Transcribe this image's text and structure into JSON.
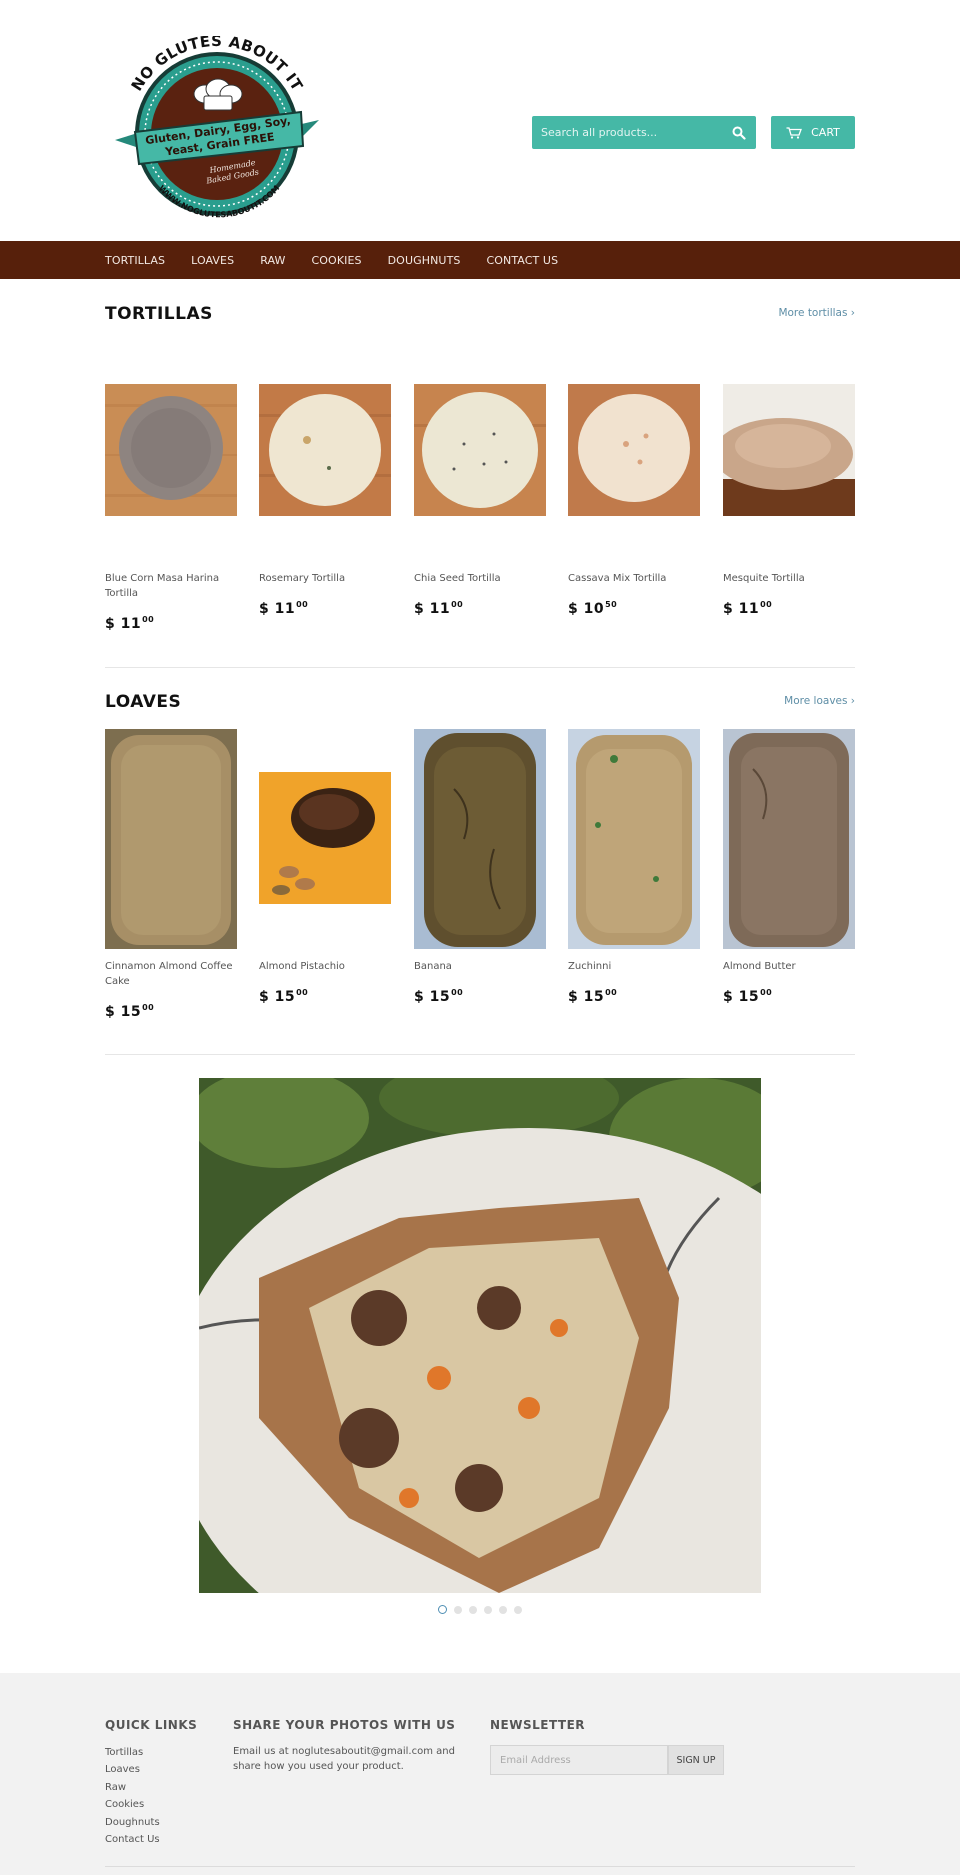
{
  "brand": {
    "logo_arc_text": "NO GLUTES ABOUT IT",
    "logo_banner_line1": "Gluten, Dairy, Egg, Soy,",
    "logo_banner_line2": "Yeast, Grain FREE",
    "logo_sub_line1": "Homemade",
    "logo_sub_line2": "Baked Goods",
    "logo_url_text": "WWW.NOGLUTESABOUTIT.COM",
    "colors": {
      "brown": "#57200b",
      "teal": "#45b8a6"
    }
  },
  "search": {
    "placeholder": "Search all products...",
    "icon": "search-icon"
  },
  "cart": {
    "label": "CART",
    "icon": "cart-icon"
  },
  "nav": {
    "items": [
      {
        "label": "TORTILLAS"
      },
      {
        "label": "LOAVES"
      },
      {
        "label": "RAW"
      },
      {
        "label": "COOKIES"
      },
      {
        "label": "DOUGHNUTS"
      },
      {
        "label": "CONTACT US"
      }
    ]
  },
  "tortillas": {
    "title": "TORTILLAS",
    "more_link": "More tortillas ›",
    "products": [
      {
        "name": "Blue Corn Masa Harina Tortilla",
        "currency": "$ ",
        "price_main": "11",
        "price_cents": "00"
      },
      {
        "name": "Rosemary Tortilla",
        "currency": "$ ",
        "price_main": "11",
        "price_cents": "00"
      },
      {
        "name": "Chia Seed Tortilla",
        "currency": "$ ",
        "price_main": "11",
        "price_cents": "00"
      },
      {
        "name": "Cassava Mix Tortilla",
        "currency": "$ ",
        "price_main": "10",
        "price_cents": "50"
      },
      {
        "name": "Mesquite Tortilla",
        "currency": "$ ",
        "price_main": "11",
        "price_cents": "00"
      }
    ]
  },
  "loaves": {
    "title": "LOAVES",
    "more_link": "More loaves ›",
    "products": [
      {
        "name": "Cinnamon Almond Coffee Cake",
        "currency": "$ ",
        "price_main": "15",
        "price_cents": "00"
      },
      {
        "name": "Almond Pistachio",
        "currency": "$ ",
        "price_main": "15",
        "price_cents": "00"
      },
      {
        "name": "Banana",
        "currency": "$ ",
        "price_main": "15",
        "price_cents": "00"
      },
      {
        "name": "Zuchinni",
        "currency": "$ ",
        "price_main": "15",
        "price_cents": "00"
      },
      {
        "name": "Almond Butter",
        "currency": "$ ",
        "price_main": "15",
        "price_cents": "00"
      }
    ]
  },
  "slideshow": {
    "slide_count": 6,
    "active_index": 0
  },
  "footer": {
    "quick_links": {
      "title": "QUICK LINKS",
      "items": [
        "Tortillas",
        "Loaves",
        "Raw",
        "Cookies",
        "Doughnuts",
        "Contact Us"
      ]
    },
    "share": {
      "title": "SHARE YOUR PHOTOS WITH US",
      "text": "Email us at noglutesaboutit@gmail.com and share how you used your product."
    },
    "newsletter": {
      "title": "NEWSLETTER",
      "placeholder": "Email Address",
      "button": "SIGN UP"
    }
  }
}
